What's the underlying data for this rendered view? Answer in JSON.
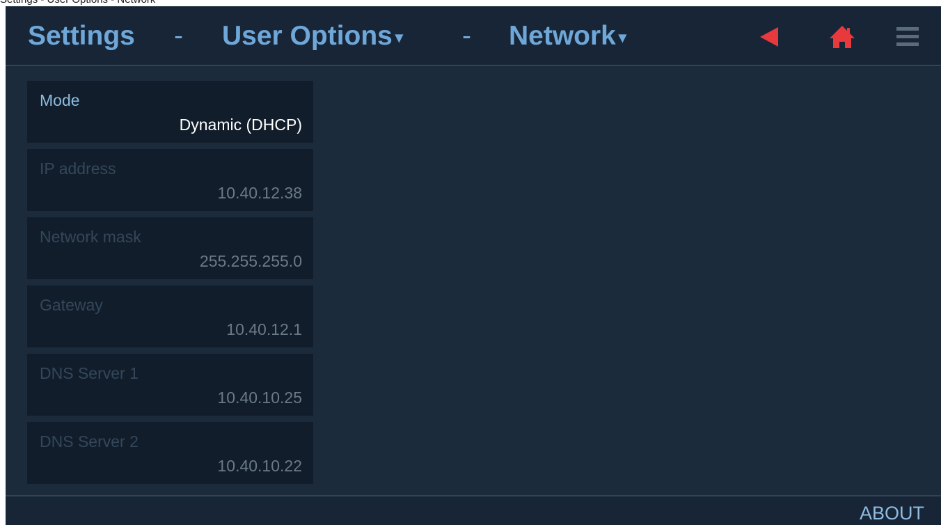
{
  "top_strip": {
    "text": "Settings - User Options - Network"
  },
  "header": {
    "crumbs": [
      {
        "label": "Settings"
      },
      {
        "label": "User Options",
        "caret": "▾"
      },
      {
        "label": "Network",
        "caret": "▾"
      }
    ],
    "separator": "-",
    "icons": [
      "back-arrow-icon",
      "home-icon",
      "menu-icon"
    ],
    "accent_color": "#e8393d"
  },
  "fields": [
    {
      "label": "Mode",
      "value": "Dynamic (DHCP)",
      "active": true
    },
    {
      "label": "IP address",
      "value": "10.40.12.38",
      "active": false
    },
    {
      "label": "Network mask",
      "value": "255.255.255.0",
      "active": false
    },
    {
      "label": "Gateway",
      "value": "10.40.12.1",
      "active": false
    },
    {
      "label": "DNS Server 1",
      "value": "10.40.10.25",
      "active": false
    },
    {
      "label": "DNS Server 2",
      "value": "10.40.10.22",
      "active": false
    }
  ],
  "footer": {
    "about_label": "ABOUT"
  }
}
